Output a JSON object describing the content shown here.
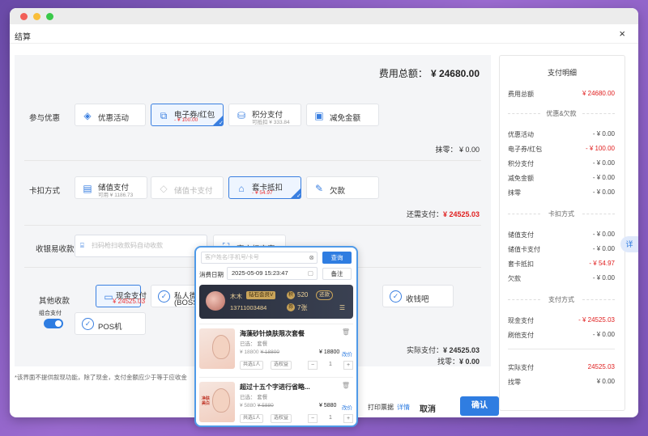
{
  "window": {
    "title": "结算",
    "close": "×"
  },
  "total": {
    "label": "费用总额：",
    "value": "¥ 24680.00"
  },
  "discount": {
    "label": "参与优惠",
    "cards": [
      {
        "label": "优惠活动",
        "sub": ""
      },
      {
        "label": "电子券/红包",
        "sub": "- ¥ 100.00"
      },
      {
        "label": "积分支付",
        "sub": "可抵扣 ¥ 333.84"
      },
      {
        "label": "减免金额",
        "sub": ""
      }
    ],
    "wipe": "抹零：  ¥ 0.00"
  },
  "card_deduct": {
    "label": "卡扣方式",
    "cards": [
      {
        "label": "储值支付",
        "sub": "可用 ¥ 1186.73"
      },
      {
        "label": "储值卡支付",
        "sub": ""
      },
      {
        "label": "套卡抵扣",
        "sub": "- ¥ 54.97"
      },
      {
        "label": "欠款",
        "sub": ""
      }
    ],
    "need_label": "还需支付：",
    "need_value": "¥ 24525.03"
  },
  "collect": {
    "label": "收银易收款",
    "scan_placeholder": "扫码枪扫收款码自动收款",
    "customer_scan": "客户扫商家"
  },
  "other": {
    "label": "其他收款",
    "combo_label": "组合支付",
    "cards": [
      {
        "label": "现金支付",
        "sub": "¥ 24525.03"
      },
      {
        "label": "私人微信",
        "sub": "(BOSS)"
      },
      {
        "label": "收钱吧",
        "sub": ""
      },
      {
        "label": "POS机",
        "sub": ""
      }
    ],
    "actual_label": "实际支付：",
    "actual_value": "¥ 24525.03",
    "change_label": "找零：",
    "change_value": "¥ 0.00"
  },
  "footer": {
    "note": "*该界面不提供叙现功能，除了现金，支付金额应少于等于应收金",
    "print": "打印票据",
    "print_detail": "详情",
    "cancel": "取消",
    "confirm": "确认"
  },
  "summary": {
    "title": "支付明细",
    "total_label": "费用总额",
    "total_value": "¥ 24680.00",
    "g1": "优惠&欠款",
    "rows1": [
      {
        "label": "优惠活动",
        "value": "- ¥ 0.00",
        "red": false
      },
      {
        "label": "电子券/红包",
        "value": "- ¥ 100.00",
        "red": true
      },
      {
        "label": "积分支付",
        "value": "- ¥ 0.00",
        "red": false
      },
      {
        "label": "减免金额",
        "value": "- ¥ 0.00",
        "red": false
      },
      {
        "label": "抹零",
        "value": "- ¥ 0.00",
        "red": false
      }
    ],
    "g2": "卡扣方式",
    "rows2": [
      {
        "label": "储值支付",
        "value": "- ¥ 0.00",
        "red": false
      },
      {
        "label": "储值卡支付",
        "value": "- ¥ 0.00",
        "red": false
      },
      {
        "label": "套卡抵扣",
        "value": "- ¥ 54.97",
        "red": true
      },
      {
        "label": "欠款",
        "value": "- ¥ 0.00",
        "red": false
      }
    ],
    "g3": "支付方式",
    "rows3": [
      {
        "label": "现金支付",
        "value": "- ¥ 24525.03",
        "red": true
      },
      {
        "label": "刷他支付",
        "value": "- ¥ 0.00",
        "red": false
      }
    ],
    "actual_label": "实际支付",
    "actual_value": "24525.03",
    "change_label": "找零",
    "change_value": "¥ 0.00",
    "tab": "详"
  },
  "popup": {
    "search_placeholder": "客户姓名/手机号/卡号",
    "search_btn": "查询",
    "date_label": "消费日期",
    "date_value": "2025-05-09 15:23:47",
    "note_btn": "备注",
    "member": {
      "name": "木木",
      "level": "钻石会员V",
      "phone": "13711003484",
      "points": "520",
      "points_tag": "还款",
      "count": "7张",
      "coin1": "积",
      "coin2": "券"
    },
    "items": [
      {
        "name": "海藻砂针焕肤限次套餐",
        "sub": "已选： 套餐",
        "price": "¥ 18800",
        "orig": "¥ 18800",
        "now": "¥ 18800",
        "edit": "改价",
        "chip1": "共选1人",
        "chip2": "选权益",
        "qty": "1",
        "thumb_text": ""
      },
      {
        "name": "超过十五个字进行省略...",
        "sub": "已选： 套餐",
        "price": "¥ 5880",
        "orig": "¥ 5880",
        "now": "¥ 5880",
        "edit": "改价",
        "chip1": "共选1人",
        "chip2": "选权益",
        "qty": "1",
        "thumb_text": "净肤美白"
      }
    ]
  }
}
